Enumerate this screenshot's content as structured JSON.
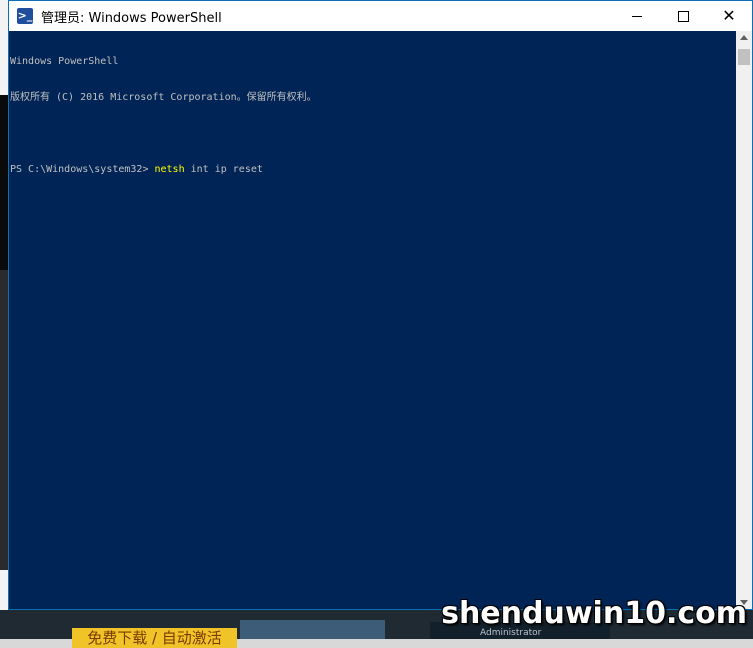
{
  "window": {
    "title": "管理员: Windows PowerShell",
    "icon": "powershell-icon"
  },
  "caption_buttons": {
    "minimize_icon": "minimize-icon",
    "maximize_icon": "maximize-icon",
    "close_icon": "close-icon"
  },
  "console": {
    "lines": [
      "Windows PowerShell",
      "版权所有 (C) 2016 Microsoft Corporation。保留所有权利。",
      "",
      "PS C:\\Windows\\system32> "
    ],
    "command": "netsh",
    "arguments": " int ip reset"
  },
  "background": {
    "banner_text": "免费下载 / 自动激活",
    "admin_label": "Administrator"
  },
  "watermark": "shenduwin10.com",
  "colors": {
    "console_bg": "#012456",
    "console_text": "#c0c0c0",
    "command_text": "#ffff00",
    "window_border": "#0a6fb5"
  }
}
